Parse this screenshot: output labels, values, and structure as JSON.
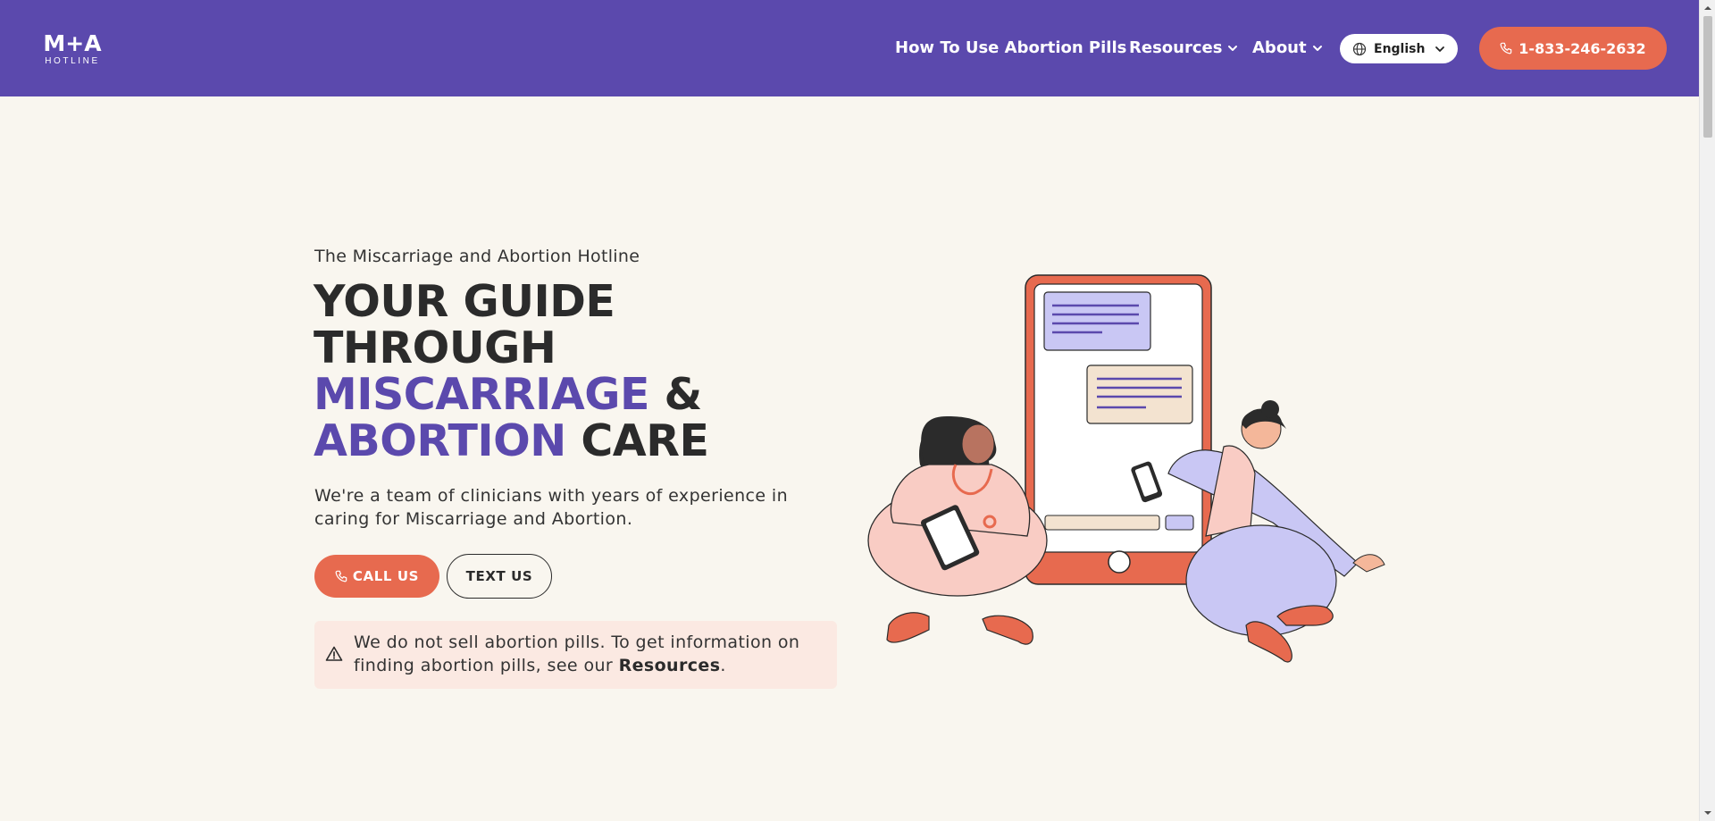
{
  "header": {
    "logo_mark": "M+A",
    "logo_sub": "HOTLINE",
    "nav": {
      "how_to": "How To Use Abortion Pills",
      "resources": "Resources",
      "about": "About"
    },
    "language": "English",
    "phone": "1-833-246-2632"
  },
  "hero": {
    "eyebrow": "The Miscarriage and Abortion Hotline",
    "headline": {
      "line1": "YOUR GUIDE",
      "line2": "THROUGH",
      "line3_purple": "MISCARRIAGE",
      "line3_rest": " &",
      "line4_purple": "ABORTION",
      "line4_rest": " CARE"
    },
    "lede": "We're a team of clinicians with years of experience in caring for Miscarriage and Abortion.",
    "call_label": "CALL US",
    "text_label": "TEXT US",
    "notice": {
      "text_before": "We do not sell abortion pills. To get information on finding abortion pills, see our ",
      "link": "Resources",
      "text_after": "."
    }
  },
  "colors": {
    "brand_purple": "#5b49ad",
    "accent_coral": "#e76a4f",
    "background": "#f9f6ef",
    "notice_bg": "#fbe9e2"
  },
  "icons": [
    "chevron-down-icon",
    "globe-icon",
    "phone-icon",
    "warning-icon"
  ]
}
